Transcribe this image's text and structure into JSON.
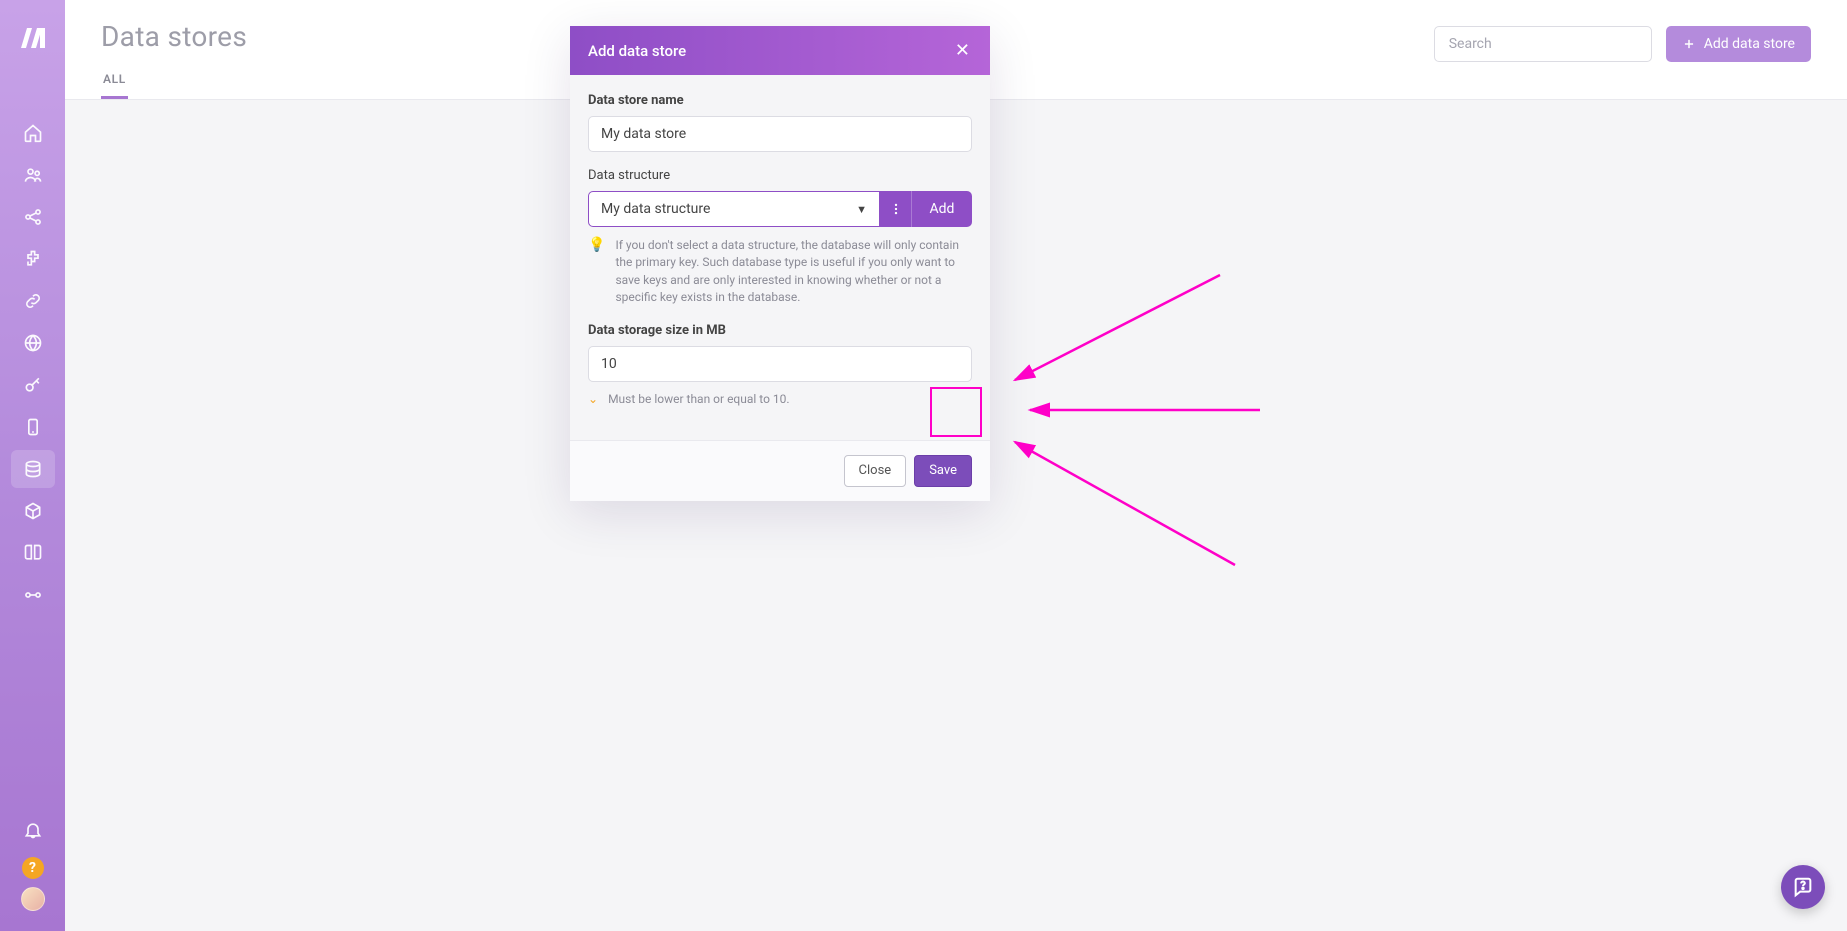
{
  "page": {
    "title": "Data stores",
    "search_placeholder": "Search",
    "add_button": "Add data store"
  },
  "tabs": [
    {
      "label": "ALL",
      "active": true
    }
  ],
  "sidebar_icons": [
    "home-icon",
    "team-icon",
    "share-icon",
    "puzzle-icon",
    "link-icon",
    "globe-icon",
    "key-icon",
    "phone-icon",
    "database-icon",
    "cube-icon",
    "book-icon",
    "git-icon"
  ],
  "modal": {
    "title": "Add data store",
    "fields": {
      "name_label": "Data store name",
      "name_value": "My data store",
      "structure_label": "Data structure",
      "structure_value": "My data structure",
      "structure_add": "Add",
      "structure_hint": "If you don't select a data structure, the database will only contain the primary key. Such database type is useful if you only want to save keys and are only interested in knowing whether or not a specific key exists in the database.",
      "size_label": "Data storage size in MB",
      "size_value": "10",
      "size_validation": "Must be lower than or equal to 10."
    },
    "footer": {
      "close": "Close",
      "save": "Save"
    }
  }
}
